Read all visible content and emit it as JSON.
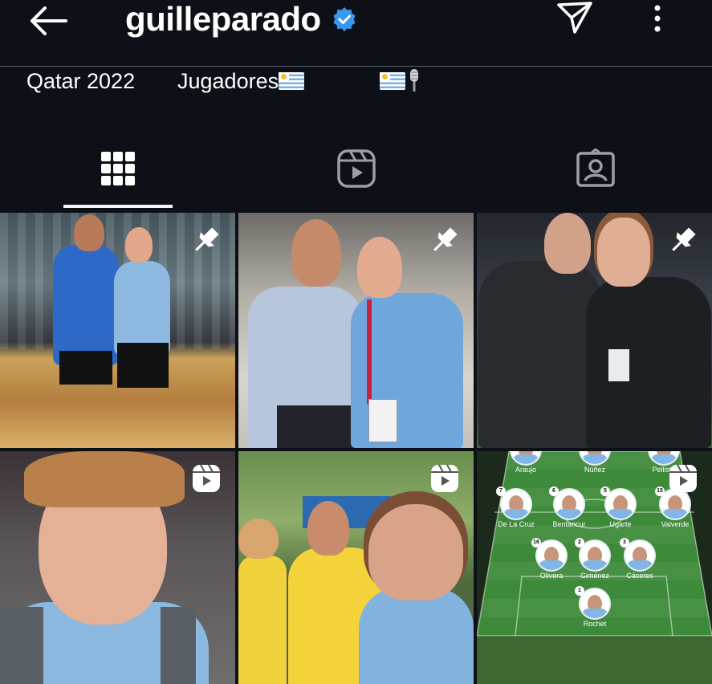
{
  "header": {
    "username": "guilleparado",
    "icons": [
      "back-arrow-icon",
      "verified-badge-icon",
      "send-icon",
      "more-icon"
    ]
  },
  "highlights": [
    {
      "label": "Qatar 2022"
    },
    {
      "label": "Jugadores",
      "emoji": "uruguay-flag"
    },
    {
      "label": "",
      "emoji": "uruguay-flag, microphone"
    }
  ],
  "tabs": [
    {
      "name": "grid",
      "icon": "grid-icon",
      "selected": true
    },
    {
      "name": "reels",
      "icon": "reels-icon",
      "selected": false
    },
    {
      "name": "tagged",
      "icon": "tagged-icon",
      "selected": false
    }
  ],
  "posts": [
    {
      "type": "pinned",
      "icon": "pin-icon"
    },
    {
      "type": "pinned",
      "icon": "pin-icon"
    },
    {
      "type": "pinned",
      "icon": "pin-icon"
    },
    {
      "type": "reel",
      "icon": "reel-icon"
    },
    {
      "type": "reel",
      "icon": "reel-icon"
    },
    {
      "type": "reel",
      "icon": "reel-icon"
    }
  ],
  "lineup": {
    "players": [
      {
        "name": "Araujo",
        "number": ""
      },
      {
        "name": "Núñez",
        "number": ""
      },
      {
        "name": "Pellistri",
        "number": ""
      },
      {
        "name": "De La Cruz",
        "number": "7"
      },
      {
        "name": "Bentancur",
        "number": "6"
      },
      {
        "name": "Ugarte",
        "number": "5"
      },
      {
        "name": "Valverde",
        "number": "15"
      },
      {
        "name": "Olivera",
        "number": "16"
      },
      {
        "name": "Giménez",
        "number": "2"
      },
      {
        "name": "Cáceres",
        "number": "3"
      },
      {
        "name": "Rochet",
        "number": "1"
      }
    ]
  },
  "colors": {
    "background": "#0d1016",
    "accent": "#3897f0",
    "divider": "#5a5f66"
  }
}
